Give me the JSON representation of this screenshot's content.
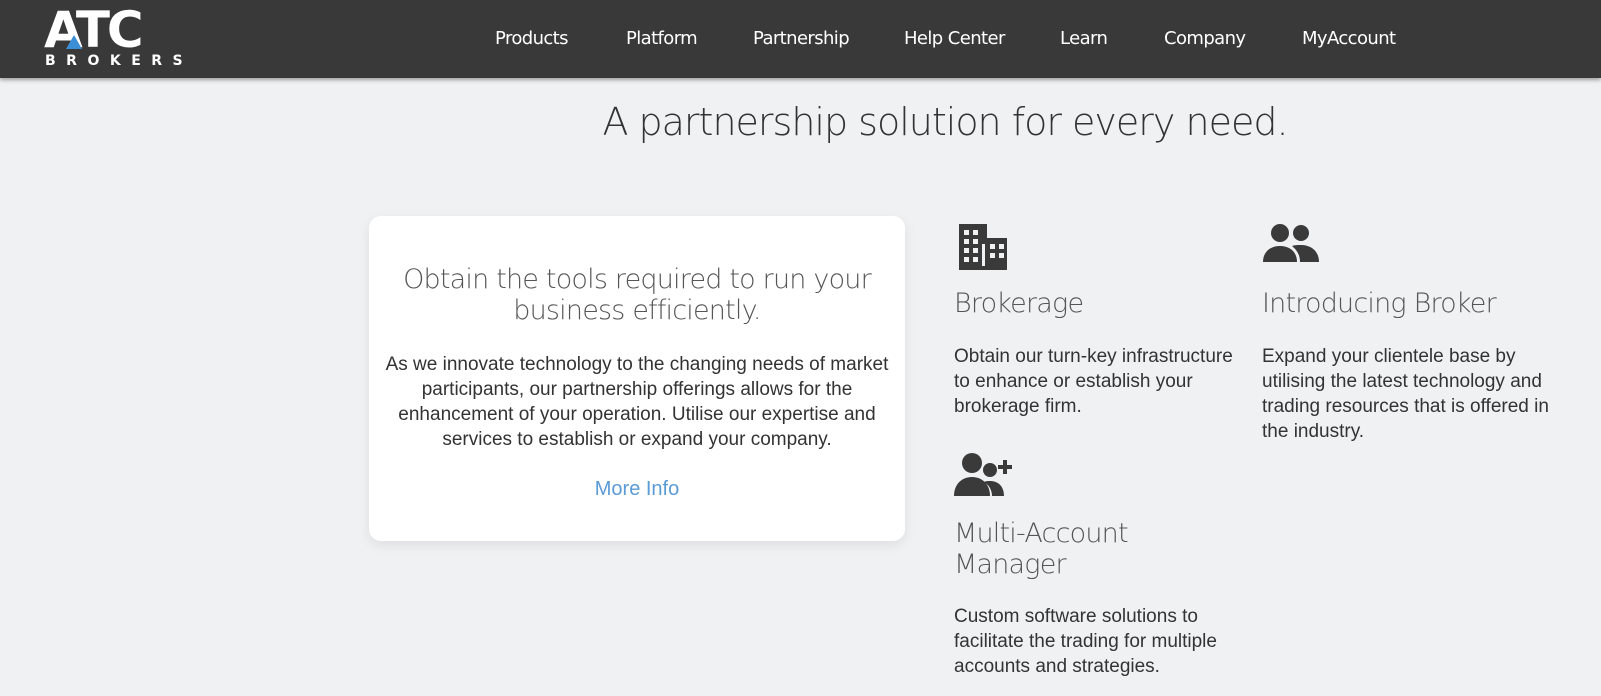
{
  "brand": {
    "logo_main": "ATC",
    "logo_sub": "BROKERS",
    "accent_color": "#3a8fd6",
    "header_bg": "#393939"
  },
  "nav": {
    "items": [
      {
        "label": "Products"
      },
      {
        "label": "Platform"
      },
      {
        "label": "Partnership"
      },
      {
        "label": "Help Center"
      },
      {
        "label": "Learn"
      },
      {
        "label": "Company"
      },
      {
        "label": "MyAccount"
      }
    ]
  },
  "hero": {
    "title": "A partnership solution for every need."
  },
  "card": {
    "heading": "Obtain the tools required to run your business efficiently.",
    "text": "As we innovate technology to the changing needs of market participants, our partnership offerings allows for the enhancement of your operation. Utilise our expertise and services to establish or expand your company.",
    "link_label": "More Info",
    "link_color": "#5b9bd5"
  },
  "features": [
    {
      "icon": "building-icon",
      "title": "Brokerage",
      "text": "Obtain our turn-key infrastructure to enhance or establish your brokerage firm."
    },
    {
      "icon": "users-icon",
      "title": "Introducing Broker",
      "text": "Expand your clientele base by utilising the latest technology and trading resources that is offered in the industry."
    },
    {
      "icon": "user-plus-icon",
      "title": "Multi-Account Manager",
      "text": "Custom software solutions to facilitate the trading for multiple accounts and strategies."
    }
  ]
}
